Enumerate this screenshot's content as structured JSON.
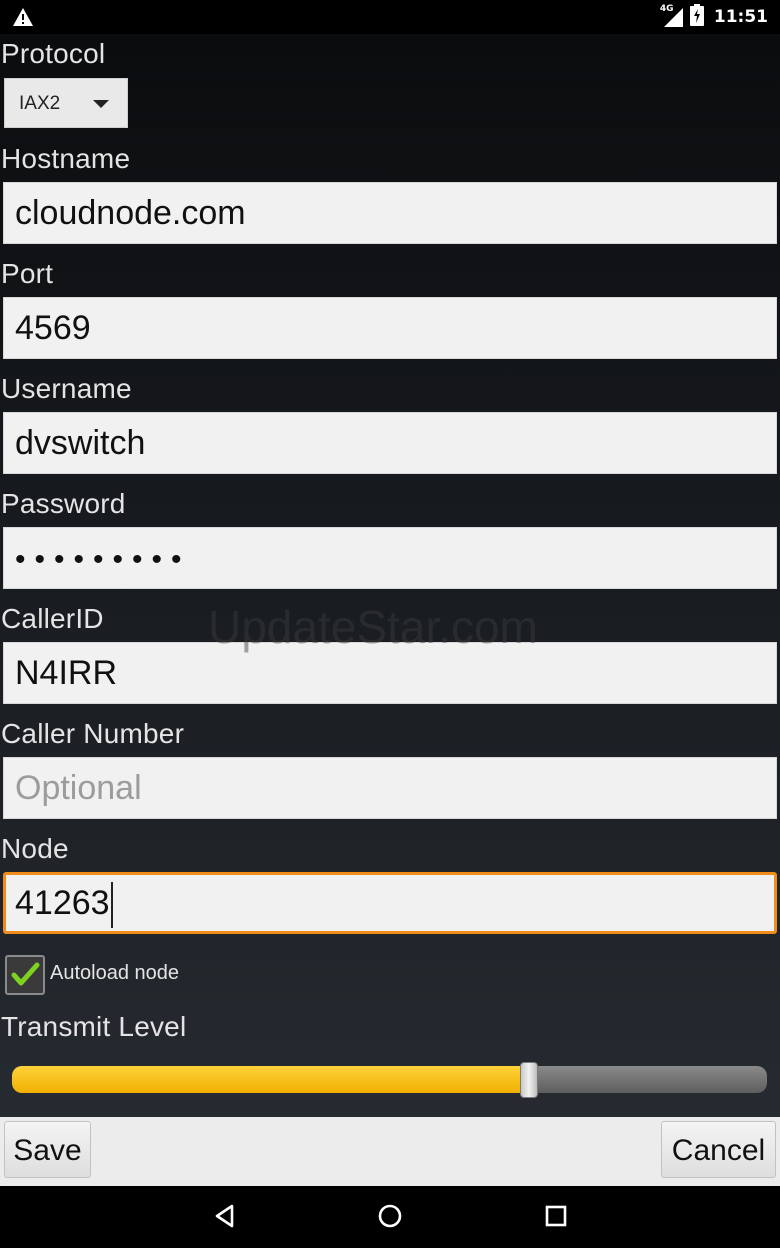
{
  "status_bar": {
    "time": "11:51",
    "network": "4G"
  },
  "protocol": {
    "label": "Protocol",
    "selected": "IAX2"
  },
  "hostname": {
    "label": "Hostname",
    "value": "cloudnode.com"
  },
  "port": {
    "label": "Port",
    "value": "4569"
  },
  "username": {
    "label": "Username",
    "value": "dvswitch"
  },
  "password": {
    "label": "Password",
    "masked": "•••••••••"
  },
  "caller_id": {
    "label": "CallerID",
    "value": "N4IRR"
  },
  "caller_number": {
    "label": "Caller Number",
    "placeholder": "Optional"
  },
  "node": {
    "label": "Node",
    "value": "41263"
  },
  "autoload": {
    "label": "Autoload node",
    "checked": true
  },
  "transmit_level": {
    "label": "Transmit Level",
    "fraction": 0.685
  },
  "buttons": {
    "save": "Save",
    "cancel": "Cancel"
  },
  "watermark": "UpdateStar.com",
  "colors": {
    "accent": "#f08c1a",
    "slider_fill": "#ffc400",
    "check": "#7ed321"
  }
}
